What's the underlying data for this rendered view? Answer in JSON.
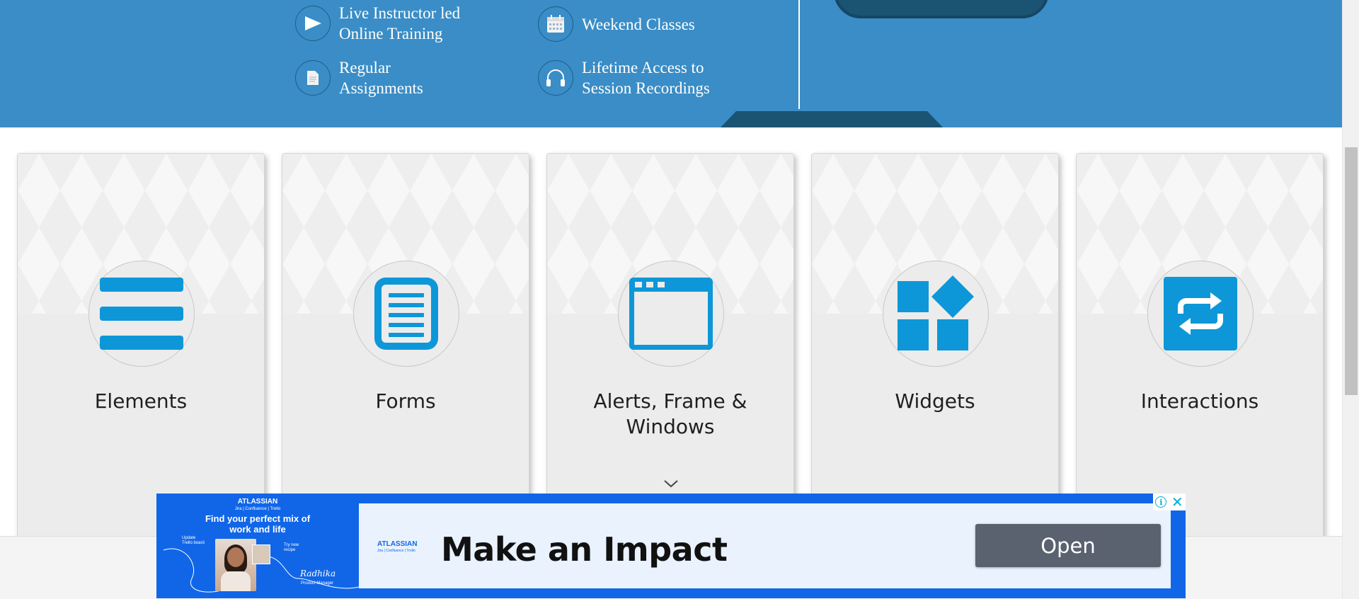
{
  "banner": {
    "features": [
      {
        "label": "Live Instructor led\nOnline Training",
        "icon": "play-icon"
      },
      {
        "label": "Regular\nAssignments",
        "icon": "document-icon"
      },
      {
        "label": "Weekend Classes",
        "icon": "calendar-icon"
      },
      {
        "label": "Lifetime Access to\nSession Recordings",
        "icon": "headphones-icon"
      }
    ]
  },
  "cards": [
    {
      "title": "Elements",
      "icon": "hamburger-icon"
    },
    {
      "title": "Forms",
      "icon": "form-document-icon"
    },
    {
      "title": "Alerts, Frame &\nWindows",
      "icon": "browser-window-icon"
    },
    {
      "title": "Widgets",
      "icon": "widgets-icon"
    },
    {
      "title": "Interactions",
      "icon": "repeat-arrows-icon"
    }
  ],
  "colors": {
    "banner": "#3a8dc6",
    "icon_blue": "#0d97d8",
    "card_bg": "#ececec",
    "ad_blue": "#1166e8",
    "open_button": "#5a6270"
  },
  "ad": {
    "brand": "ATLASSIAN",
    "brand_sub": "Jira | Confluence | Trello",
    "headline": "Find your perfect mix of work and life",
    "note_left": "Update\nTrello board",
    "note_right": "Try new\nrecipe",
    "signature": "Radhika",
    "role": "Product Manager",
    "right_brand": "ATLASSIAN",
    "right_brand_sub": "Jira | Confluence | Trello",
    "title": "Make an Impact",
    "button": "Open"
  }
}
